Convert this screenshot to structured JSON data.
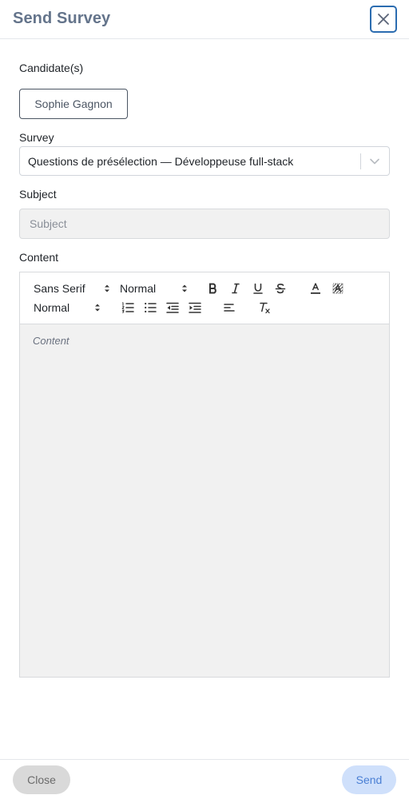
{
  "dialog": {
    "title": "Send Survey",
    "close_icon": "close-x-icon"
  },
  "candidates": {
    "label": "Candidate(s)",
    "items": [
      "Sophie Gagnon"
    ]
  },
  "survey": {
    "label": "Survey",
    "selected": "Questions de présélection — Développeuse full-stack",
    "icon": "chevron-down-icon"
  },
  "subject": {
    "label": "Subject",
    "value": "",
    "placeholder": "Subject"
  },
  "content": {
    "label": "Content",
    "placeholder": "Content",
    "toolbar": {
      "font": "Sans Serif",
      "size": "Normal",
      "heading": "Normal",
      "buttons": [
        "bold-icon",
        "italic-icon",
        "underline-icon",
        "strikethrough-icon",
        "text-color-icon",
        "background-color-icon",
        "ordered-list-icon",
        "bullet-list-icon",
        "outdent-icon",
        "indent-icon",
        "align-icon",
        "clear-format-icon"
      ]
    }
  },
  "footer": {
    "close_label": "Close",
    "send_label": "Send"
  },
  "colors": {
    "accent": "#2b6cb0",
    "send_bg": "#cfe0fb",
    "send_text": "#4a7fd4",
    "close_bg": "#d9d9d9"
  }
}
